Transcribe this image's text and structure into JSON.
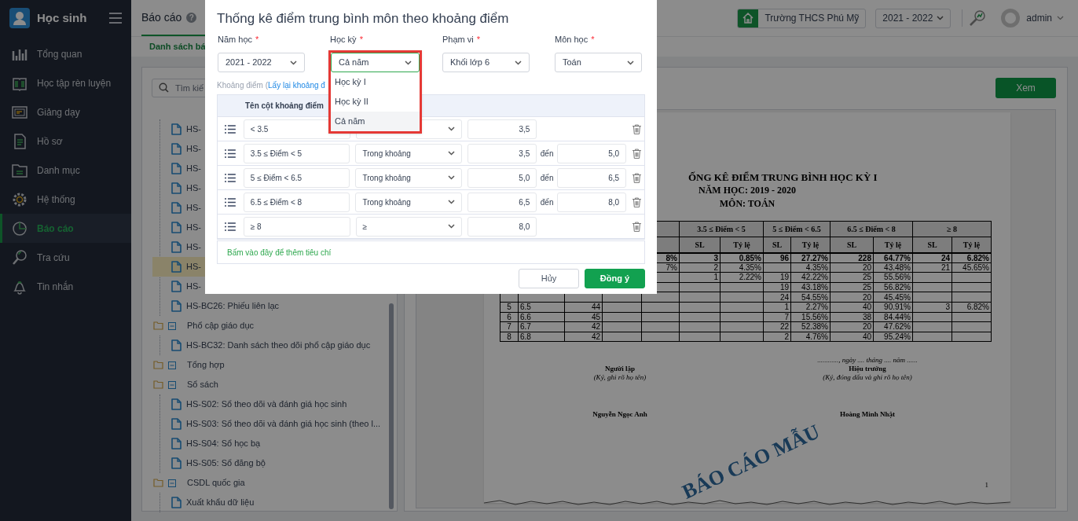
{
  "sidebar": {
    "title": "Học sinh",
    "items": [
      {
        "label": "Tổng quan",
        "selected": false
      },
      {
        "label": "Học tập rèn luyện",
        "selected": false
      },
      {
        "label": "Giảng dạy",
        "selected": false
      },
      {
        "label": "Hồ sơ",
        "selected": false
      },
      {
        "label": "Danh mục",
        "selected": false
      },
      {
        "label": "Hệ thống",
        "selected": false
      },
      {
        "label": "Báo cáo",
        "selected": true
      },
      {
        "label": "Tra cứu",
        "selected": false
      },
      {
        "label": "Tin nhắn",
        "selected": false
      }
    ]
  },
  "header": {
    "title": "Báo cáo",
    "help": "?",
    "school": "Trường THCS Phú Mỹ",
    "year": "2021 - 2022",
    "user": "admin"
  },
  "subtab": "Danh sách bá",
  "search": {
    "placeholder": "Tìm kiế"
  },
  "tree": [
    {
      "children": [
        {
          "label": "HS-",
          "selected": false
        },
        {
          "label": "HS-",
          "selected": false
        },
        {
          "label": "HS-",
          "selected": false
        },
        {
          "label": "HS-",
          "selected": false
        },
        {
          "label": "HS-",
          "selected": false
        },
        {
          "label": "HS-",
          "selected": false
        },
        {
          "label": "HS-",
          "selected": false
        },
        {
          "label": "HS-",
          "selected": true
        },
        {
          "label": "HS-",
          "selected": false
        },
        {
          "label": "HS-BC26: Phiếu liên lạc",
          "selected": false
        }
      ]
    },
    {
      "label": "Phổ cập giáo dục",
      "expanded": true,
      "children": [
        {
          "label": "HS-BC32: Danh sách theo dõi phổ cập giáo dục",
          "selected": false
        }
      ]
    },
    {
      "label": "Tổng hợp",
      "expanded": true
    },
    {
      "label": "Sổ sách",
      "expanded": true,
      "children": [
        {
          "label": "HS-S02: Sổ theo dõi và đánh giá học sinh",
          "selected": false
        },
        {
          "label": "HS-S03: Sổ theo dõi và đánh giá học sinh (theo l...",
          "selected": false
        },
        {
          "label": "HS-S04: Sổ học bạ",
          "selected": false
        },
        {
          "label": "HS-S05: Sổ đăng bộ",
          "selected": false
        }
      ]
    },
    {
      "label": "CSDL quốc gia",
      "expanded": true,
      "children": [
        {
          "label": "Xuất khẩu dữ liệu",
          "selected": false
        }
      ]
    }
  ],
  "view_button": "Xem",
  "report": {
    "title_lines": [
      "ỐNG KÊ ĐIỂM TRUNG BÌNH HỌC KỲ I",
      "NĂM HỌC: 2019 - 2020",
      "MÔN: TOÁN"
    ],
    "table": {
      "group_headers": [
        "3.5 ≤ Điểm < 5",
        "5 ≤ Điểm < 6.5",
        "6.5 ≤ Điểm < 8",
        "≥ 8"
      ],
      "sub_headers": [
        "SL",
        "Tỷ lệ",
        "SL",
        "Tỷ lệ",
        "SL",
        "Tỷ lệ",
        "SL",
        "Tỷ lệ"
      ],
      "rows": [
        {
          "kind": "total",
          "cells": [
            null,
            null,
            null,
            null,
            "8%",
            "3",
            "0.85%",
            "96",
            "27.27%",
            "228",
            "64.77%",
            "24",
            "6.82%"
          ]
        },
        {
          "kind": "class",
          "cells": [
            null,
            null,
            null,
            null,
            "7%",
            "2",
            "4.35%",
            null,
            "4.35%",
            "20",
            "43.48%",
            "21",
            "45.65%"
          ]
        },
        {
          "kind": "class",
          "cells": [
            null,
            null,
            null,
            null,
            null,
            "1",
            "2.22%",
            "19",
            "42.22%",
            "25",
            "55.56%",
            null,
            null
          ]
        },
        {
          "kind": "class",
          "cells": [
            null,
            null,
            null,
            null,
            null,
            null,
            null,
            "19",
            "43.18%",
            "25",
            "56.82%",
            null,
            null
          ]
        },
        {
          "kind": "class",
          "cells": [
            null,
            null,
            null,
            null,
            null,
            null,
            null,
            "24",
            "54.55%",
            "20",
            "45.45%",
            null,
            null
          ]
        },
        {
          "kind": "class",
          "cells": [
            "5",
            "6.5",
            "44",
            null,
            null,
            null,
            null,
            "1",
            "2.27%",
            "40",
            "90.91%",
            "3",
            "6.82%"
          ]
        },
        {
          "kind": "class",
          "cells": [
            "6",
            "6.6",
            "45",
            null,
            null,
            null,
            null,
            "7",
            "15.56%",
            "38",
            "84.44%",
            null,
            null
          ]
        },
        {
          "kind": "class",
          "cells": [
            "7",
            "6.7",
            "42",
            null,
            null,
            null,
            null,
            "22",
            "52.38%",
            "20",
            "47.62%",
            null,
            null
          ]
        },
        {
          "kind": "class",
          "cells": [
            "8",
            "6.8",
            "42",
            null,
            null,
            null,
            null,
            "2",
            "4.76%",
            "40",
            "95.24%",
            null,
            null
          ]
        }
      ]
    },
    "date_line": "............, ngày .... tháng .... năm ......",
    "signers": [
      {
        "role": "Người lập",
        "note": "(Ký, ghi rõ họ tên)",
        "name": "Nguyễn Ngọc Anh"
      },
      {
        "role": "Hiệu trưởng",
        "note": "(Ký, đóng dấu và ghi rõ họ tên)",
        "name": "Hoàng Minh Nhật"
      }
    ],
    "watermark": "BÁO CÁO MẪU",
    "page_number": "1"
  },
  "dialog": {
    "title": "Thống kê điểm trung bình môn theo khoảng điểm",
    "fields": [
      {
        "label": "Năm học",
        "required_mark": "*",
        "value": "2021 - 2022",
        "focused": false
      },
      {
        "label": "Học kỳ",
        "required_mark": "*",
        "value": "Cả năm",
        "focused": true,
        "options": [
          {
            "label": "Học kỳ I",
            "selected": false
          },
          {
            "label": "Học kỳ II",
            "selected": false
          },
          {
            "label": "Cả năm",
            "selected": true
          }
        ]
      },
      {
        "label": "Phạm vi",
        "required_mark": "*",
        "value": "Khối lớp 6",
        "focused": false
      },
      {
        "label": "Môn học",
        "required_mark": "*",
        "value": "Toán",
        "focused": false
      }
    ],
    "range_label": "Khoảng điểm (",
    "reset_link": "Lấy lại khoảng đ",
    "column_header": "Tên cột khoảng điểm",
    "criteria": [
      {
        "name": "< 3.5",
        "from": "3,5"
      },
      {
        "name": "3.5 ≤ Điểm < 5",
        "type": "Trong khoảng",
        "from": "3,5",
        "to_label": "đến",
        "to": "5,0"
      },
      {
        "name": "5 ≤ Điểm < 6.5",
        "type": "Trong khoảng",
        "from": "5,0",
        "to_label": "đến",
        "to": "6,5"
      },
      {
        "name": "6.5 ≤ Điểm < 8",
        "type": "Trong khoảng",
        "from": "6,5",
        "to_label": "đến",
        "to": "8,0"
      },
      {
        "name": "≥ 8",
        "type": "≥",
        "from": "8,0"
      }
    ],
    "add_link": "Bấm vào đây để thêm tiêu chí",
    "buttons": [
      {
        "label": "Hủy",
        "kind": "secondary"
      },
      {
        "label": "Đồng ý",
        "kind": "primary"
      }
    ]
  }
}
